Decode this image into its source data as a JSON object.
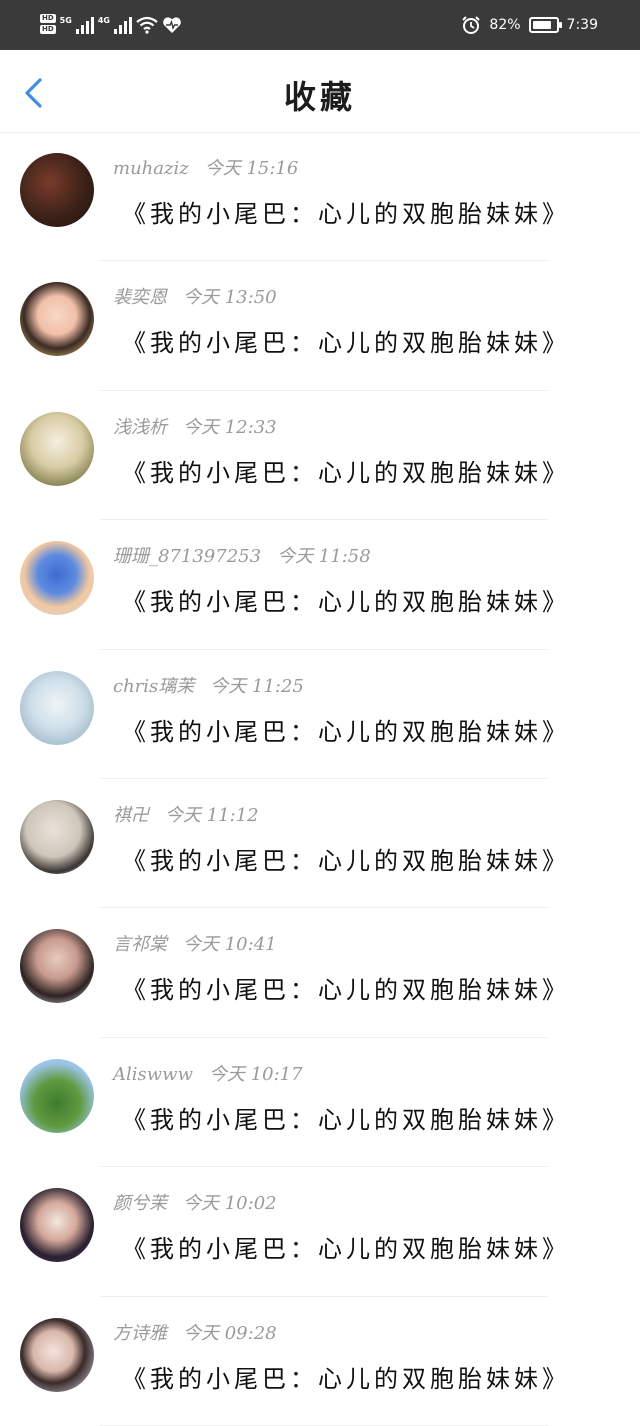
{
  "status_bar": {
    "hd_top": "HD",
    "hd_bottom": "HD",
    "net1": "5G",
    "net2": "4G",
    "battery_level": 82,
    "battery_text": "82%",
    "time": "7:39",
    "icons": [
      "signal-icon",
      "wifi-icon",
      "heart-icon",
      "alarm-icon",
      "battery-icon"
    ]
  },
  "header": {
    "back_icon": "chevron-left-icon",
    "title": "收藏",
    "accent": "#3f8fe0"
  },
  "items": [
    {
      "user": "muhaziz",
      "time": "今天 15:16",
      "text": "《我的小尾巴：心儿的双胞胎妹妹》"
    },
    {
      "user": "裴奕恩",
      "time": "今天 13:50",
      "text": "《我的小尾巴：心儿的双胞胎妹妹》"
    },
    {
      "user": "浅浅析",
      "time": "今天 12:33",
      "text": "《我的小尾巴：心儿的双胞胎妹妹》"
    },
    {
      "user": "珊珊_871397253",
      "time": "今天 11:58",
      "text": "《我的小尾巴：心儿的双胞胎妹妹》"
    },
    {
      "user": "chris璃茉",
      "time": "今天 11:25",
      "text": "《我的小尾巴：心儿的双胞胎妹妹》"
    },
    {
      "user": "祺卍",
      "time": "今天 11:12",
      "text": "《我的小尾巴：心儿的双胞胎妹妹》"
    },
    {
      "user": "言祁棠",
      "time": "今天 10:41",
      "text": "《我的小尾巴：心儿的双胞胎妹妹》"
    },
    {
      "user": "Aliswww",
      "time": "今天 10:17",
      "text": "《我的小尾巴：心儿的双胞胎妹妹》"
    },
    {
      "user": "颜兮茉",
      "time": "今天 10:02",
      "text": "《我的小尾巴：心儿的双胞胎妹妹》"
    },
    {
      "user": "方诗雅",
      "time": "今天 09:28",
      "text": "《我的小尾巴：心儿的双胞胎妹妹》"
    }
  ]
}
